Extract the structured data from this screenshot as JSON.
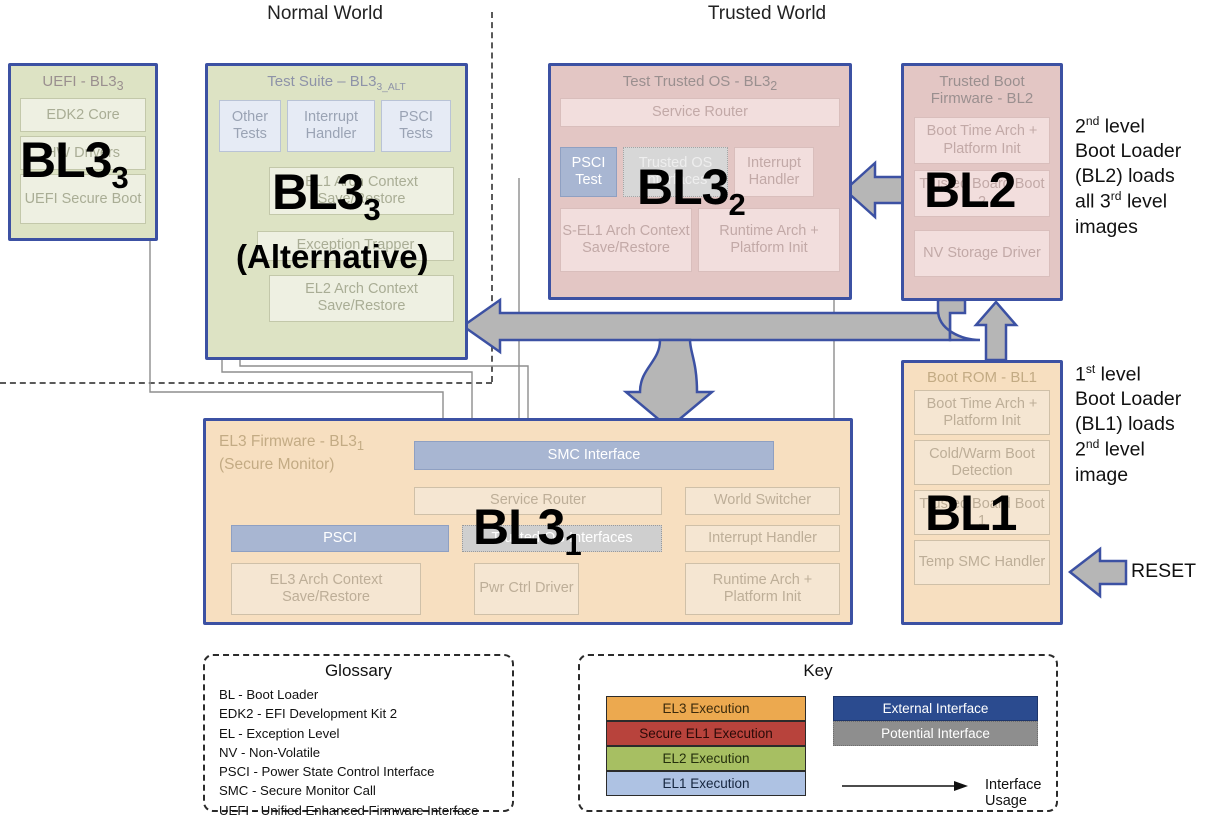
{
  "headers": {
    "normal_world": "Normal World",
    "trusted_world": "Trusted World"
  },
  "boxes": {
    "uefi": {
      "title": "UEFI - BL3",
      "title_sub": "3",
      "overlay": "BL3",
      "overlay_sub": "3",
      "items": [
        "EDK2 Core",
        "HW Drivers",
        "UEFI Secure Boot"
      ]
    },
    "test_suite": {
      "title": "Test Suite – BL3",
      "title_sub": "3_ALT",
      "overlay": "BL3",
      "overlay_sub": "3",
      "overlay_note": "(Alternative)",
      "top_items": [
        "Other Tests",
        "Interrupt Handler",
        "PSCI Tests"
      ],
      "items": [
        "EL1 Arch Context Save/Restore",
        "Exception Trapper",
        "EL2 Arch Context Save/Restore"
      ]
    },
    "test_trusted_os": {
      "title": "Test Trusted OS - BL3",
      "title_sub": "2",
      "overlay": "BL3",
      "overlay_sub": "2",
      "service_router": "Service Router",
      "psci_test": "PSCI Test",
      "trusted_os_interfaces": "Trusted OS Interfaces",
      "interrupt_handler": "Interrupt Handler",
      "sel1_context": "S-EL1 Arch Context Save/Restore",
      "runtime_arch": "Runtime Arch + Platform Init"
    },
    "trusted_boot_fw": {
      "title": "Trusted Boot Firmware - BL2",
      "overlay": "BL2",
      "items": [
        "Boot Time Arch + Platform Init",
        "Trusted Board Boot 2",
        "NV Storage Driver"
      ]
    },
    "boot_rom": {
      "title": "Boot ROM - BL1",
      "overlay": "BL1",
      "items": [
        "Boot Time Arch + Platform Init",
        "Cold/Warm Boot Detection",
        "Trusted Board Boot 1",
        "Temp SMC Handler"
      ]
    },
    "el3_firmware": {
      "title_line1": "EL3 Firmware - BL3",
      "title_sub": "1",
      "title_line2": "(Secure Monitor)",
      "overlay": "BL3",
      "overlay_sub": "1",
      "smc_interface": "SMC Interface",
      "service_router": "Service Router",
      "world_switcher": "World Switcher",
      "psci": "PSCI",
      "trusted_os_interfaces": "Trusted OS Interfaces",
      "interrupt_handler": "Interrupt Handler",
      "el3_context": "EL3 Arch Context Save/Restore",
      "pwr_ctrl": "Pwr Ctrl Driver",
      "runtime_arch": "Runtime Arch + Platform Init"
    }
  },
  "notes": {
    "bl2_note": [
      "2nd level",
      "Boot Loader",
      "(BL2) loads",
      "all 3rd level",
      "images"
    ],
    "bl2_note_line1_num": "2",
    "bl2_note_line1_sup": "nd",
    "bl2_note_line1_rest": " level",
    "bl2_note_line4_num": "all 3",
    "bl2_note_line4_sup": "rd",
    "bl2_note_line4_rest": " level",
    "bl1_note_line1_num": "1",
    "bl1_note_line1_sup": "st",
    "bl1_note_line1_rest": " level",
    "bl1_note_line2": "Boot Loader",
    "bl1_note_line3": "(BL1) loads",
    "bl1_note_line4_num": "2",
    "bl1_note_line4_sup": "nd",
    "bl1_note_line4_rest": " level",
    "bl1_note_line5": "image",
    "bl2_note_line2": "Boot Loader",
    "bl2_note_line3": "(BL2) loads",
    "bl2_note_line5": "images",
    "reset": "RESET"
  },
  "glossary": {
    "title": "Glossary",
    "entries": [
      "BL - Boot Loader",
      "EDK2 - EFI Development Kit 2",
      "EL - Exception Level",
      "NV - Non-Volatile",
      "PSCI - Power State Control Interface",
      "SMC - Secure Monitor Call",
      "UEFI - Unified Enhanced Firmware Interface"
    ]
  },
  "key": {
    "title": "Key",
    "exec_levels": [
      {
        "label": "EL3 Execution",
        "color": "#eca94f"
      },
      {
        "label": "Secure EL1 Execution",
        "color": "#b8433c"
      },
      {
        "label": "EL2 Execution",
        "color": "#a7bf62"
      },
      {
        "label": "EL1 Execution",
        "color": "#aec2e3"
      }
    ],
    "interfaces": [
      {
        "label": "External Interface",
        "color": "#2b4b8f"
      },
      {
        "label": "Potential Interface",
        "color": "#8e8e8e"
      }
    ],
    "usage_label": "Interface Usage"
  }
}
